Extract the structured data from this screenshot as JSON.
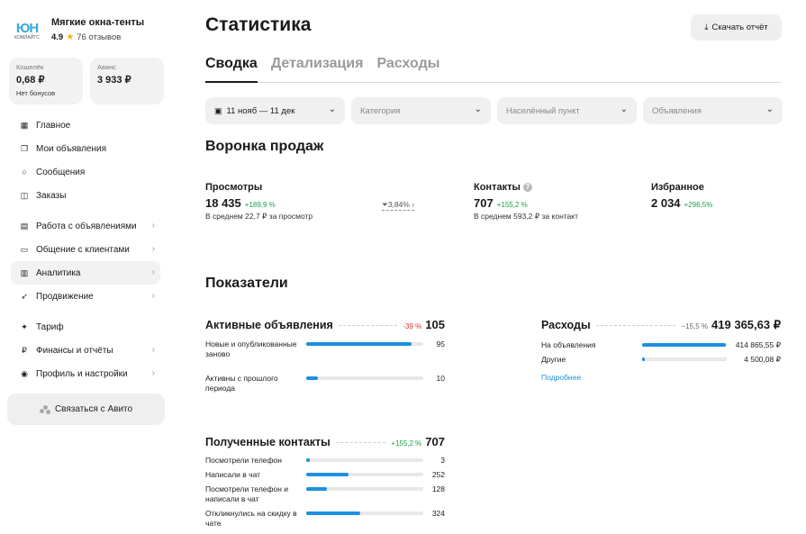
{
  "brand": {
    "logo_text": "ЮН",
    "logo_sub": "КОМЛАЙТС",
    "name": "Мягкие окна-тенты",
    "rating": "4.9",
    "reviews": "76 отзывов"
  },
  "wallet": {
    "label": "Кошелёк",
    "value": "0,68 ₽",
    "sub": "Нет бонусов"
  },
  "advance": {
    "label": "Аванс",
    "value": "3 933 ₽"
  },
  "nav": [
    {
      "label": "Главное",
      "icon": "grid-icon"
    },
    {
      "label": "Мои объявления",
      "icon": "copy-icon"
    },
    {
      "label": "Сообщения",
      "icon": "chat-icon"
    },
    {
      "label": "Заказы",
      "icon": "box-icon"
    },
    {
      "label": "Работа с объявлениями",
      "icon": "clipboard-icon"
    },
    {
      "label": "Общение с клиентами",
      "icon": "chat-bubble-icon"
    },
    {
      "label": "Аналитика",
      "icon": "chart-icon"
    },
    {
      "label": "Продвижение",
      "icon": "rocket-icon"
    },
    {
      "label": "Тариф",
      "icon": "tariff-icon"
    },
    {
      "label": "Финансы и отчёты",
      "icon": "ruble-icon"
    },
    {
      "label": "Профиль и настройки",
      "icon": "user-icon"
    }
  ],
  "contact_button": "Связаться с Авито",
  "page": {
    "title": "Статистика",
    "download": "Скачать отчёт",
    "tabs": [
      "Сводка",
      "Детализация",
      "Расходы"
    ]
  },
  "filters": {
    "date": "11 нояб — 11 дек",
    "category": "Категория",
    "city": "Населённый пункт",
    "ads": "Объявления"
  },
  "funnel": {
    "title": "Воронка продаж",
    "views": {
      "label": "Просмотры",
      "value": "18 435",
      "delta": "+189,9 %",
      "avg": "В среднем 22,7 ₽ за просмотр"
    },
    "conversion": "3,84%",
    "contacts": {
      "label": "Контакты",
      "value": "707",
      "delta": "+155,2 %",
      "avg": "В среднем 593,2 ₽ за контакт"
    },
    "favorites": {
      "label": "Избранное",
      "value": "2 034",
      "delta": "+296,5%"
    }
  },
  "indicators": {
    "title": "Показатели",
    "active_ads": {
      "title": "Активные объявления",
      "delta": "-39 %",
      "total": "105",
      "rows": [
        {
          "label": "Новые и опубликованные заново",
          "value": "95",
          "fraction": 0.9
        },
        {
          "label": "Активны с прошлого периода",
          "value": "10",
          "fraction": 0.1
        }
      ]
    },
    "expenses": {
      "title": "Расходы",
      "delta": "−15,5 %",
      "total": "419 365,63 ₽",
      "rows": [
        {
          "label": "На объявления",
          "value": "414 865,55 ₽",
          "fraction": 0.99
        },
        {
          "label": "Другие",
          "value": "4 500,08 ₽",
          "fraction": 0.02
        }
      ],
      "more": "Подробнее"
    },
    "contacts": {
      "title": "Полученные контакты",
      "delta": "+155,2 %",
      "total": "707",
      "rows": [
        {
          "label": "Посмотрели телефон",
          "value": "3",
          "fraction": 0.02
        },
        {
          "label": "Написали в чат",
          "value": "252",
          "fraction": 0.36
        },
        {
          "label": "Посмотрели телефон и написали в чат",
          "value": "128",
          "fraction": 0.18
        },
        {
          "label": "Откликнулись на скидку в чате",
          "value": "324",
          "fraction": 0.46
        }
      ]
    }
  },
  "colors": {
    "accent": "#1d8fe1",
    "positive": "#19a049",
    "negative": "#e0302b",
    "brand": "#3aa7d8"
  }
}
